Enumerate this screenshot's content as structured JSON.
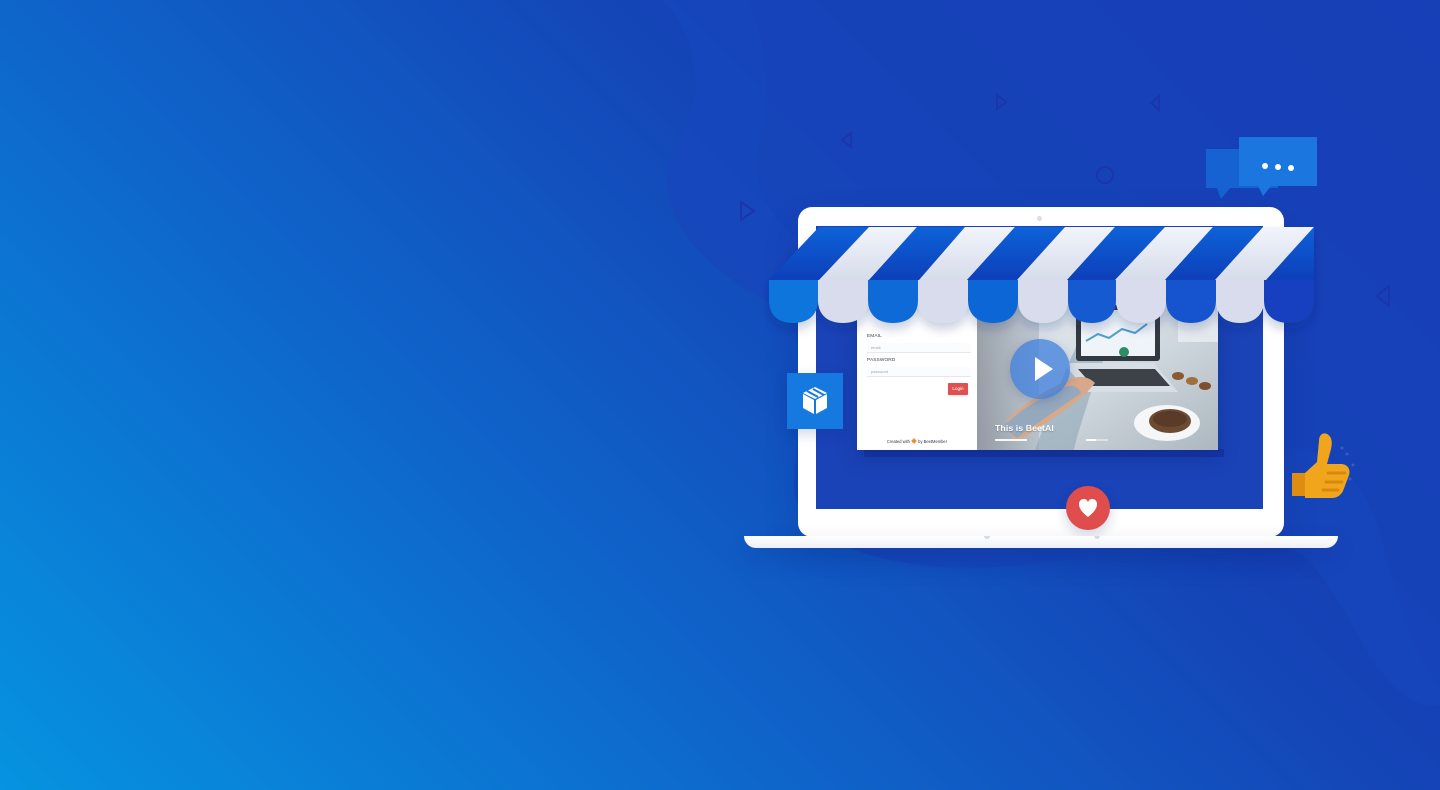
{
  "screen": {
    "login": {
      "email_label": "EMAIL",
      "email_placeholder": "email",
      "password_label": "PASSWORD",
      "password_placeholder": "password",
      "login_button": "Login",
      "credit_prefix": "Created with",
      "credit_suffix": "by BeetMember"
    },
    "hero": {
      "title": "This is BeetAI"
    }
  },
  "icons": {
    "box": "box-icon",
    "heart": "heart-icon",
    "chat": "chat-bubble-icon",
    "thumb": "thumbs-up-icon",
    "play": "play-icon"
  },
  "colors": {
    "background_start": "#0693e0",
    "background_end": "#1a2aa6",
    "awning_blue": "#1252cf",
    "awning_white": "#dde1ef",
    "login_button": "#df5050",
    "heart_badge": "#df4d4d",
    "thumb": "#f1a51c"
  }
}
